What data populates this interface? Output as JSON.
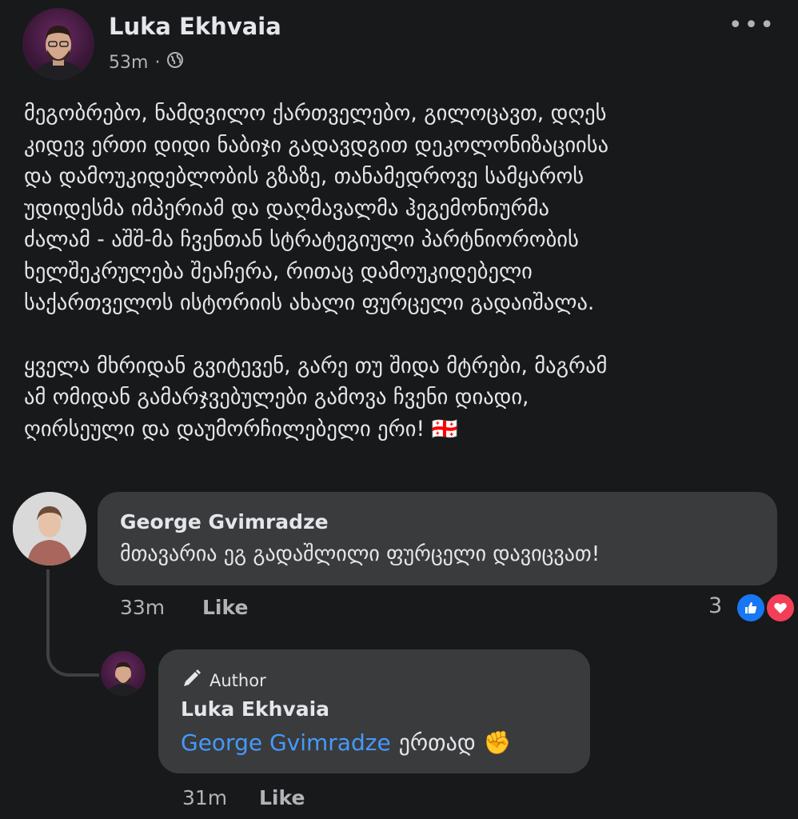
{
  "post": {
    "author": "Luka Ekhvaia",
    "time": "53m",
    "separator": "·",
    "paragraphs": [
      "მეგობრებო, ნამდვილო ქართველებო, გილოცავთ, დღეს\nკიდევ ერთი დიდი ნაბიჯი გადავდგით დეკოლონიზაციისა\nდა დამოუკიდებლობის გზაზე, თანამედროვე სამყაროს\nუდიდესმა იმპერიამ და დაღმავალმა ჰეგემონიურმა\nძალამ -  აშშ-მა ჩვენთან სტრატეგიული პარტნიორობის\nხელშეკრულება შეაჩერა, რითაც დამოუკიდებელი\nსაქართველოს ისტორიის ახალი ფურცელი გადაიშალა.",
      "ყველა მხრიდან გვიტევენ, გარე თუ შიდა მტრები, მაგრამ\nამ ომიდან გამარჯვებულები გამოვა ჩვენი დიადი,\nღირსეული და დაუმორჩილებელი ერი! 🇬🇪"
    ]
  },
  "comment": {
    "author": "George Gvimradze",
    "text": "მთავარია ეგ გადაშლილი ფურცელი დავიცვათ!",
    "time": "33m",
    "like_label": "Like",
    "reaction_count": "3"
  },
  "reply": {
    "badge": "Author",
    "author": "Luka Ekhvaia",
    "mention": "George Gvimradze",
    "text": "ერთად",
    "emoji": "✊",
    "time": "31m",
    "like_label": "Like"
  },
  "colors": {
    "background": "#18191a",
    "bubble": "#3a3b3c",
    "mention": "#4599ff",
    "like_blue": "#1877f2",
    "love_red": "#f33e58"
  },
  "icons": [
    "globe-icon",
    "more-options-icon",
    "like-reaction-icon",
    "love-reaction-icon",
    "pen-icon"
  ]
}
